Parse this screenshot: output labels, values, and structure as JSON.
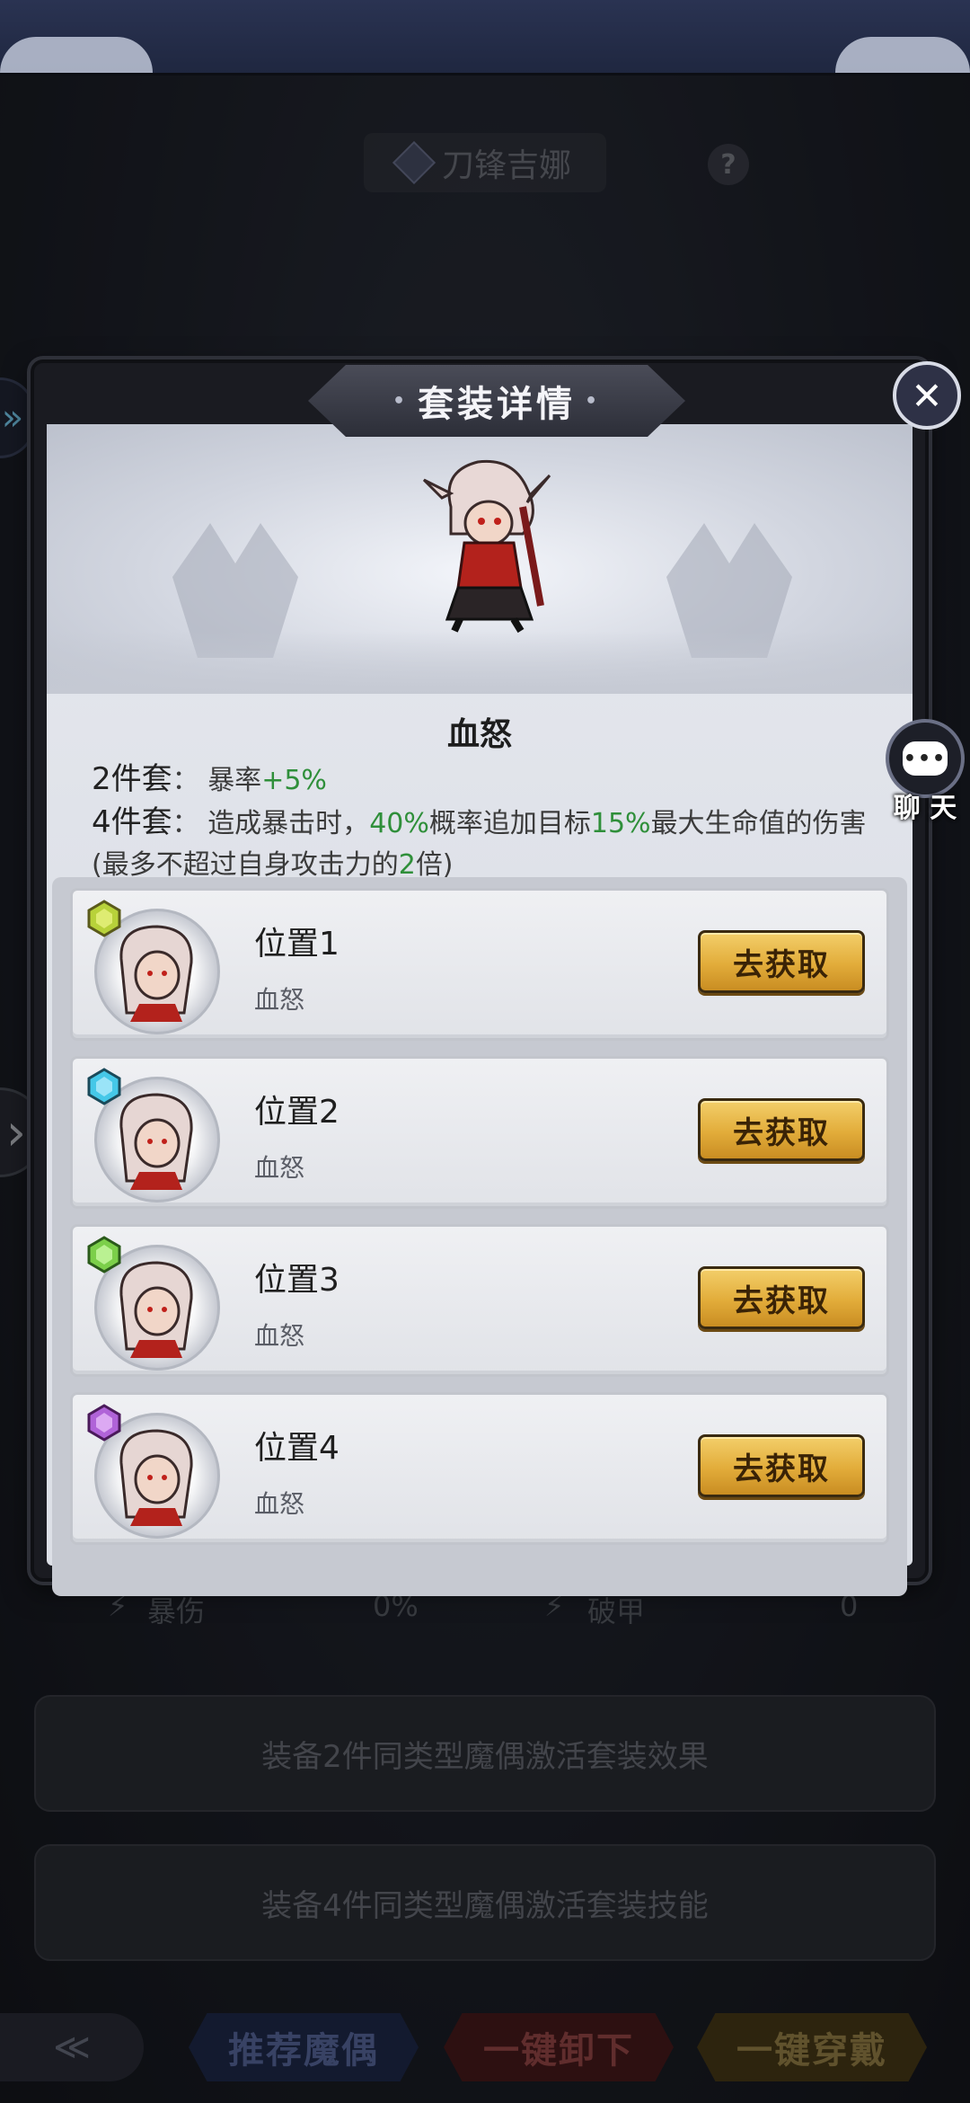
{
  "background": {
    "hero_name": "刀锋吉娜",
    "help_label": "?",
    "stats": [
      {
        "label": "暴伤",
        "value": "0%"
      },
      {
        "label": "破甲",
        "value": "0"
      }
    ],
    "hint_2": "装备2件同类型魔偶激活套装效果",
    "hint_4": "装备4件同类型魔偶激活套装技能",
    "buttons": {
      "recommend": "推荐魔偶",
      "unequip_all": "一键卸下",
      "equip_all": "一键穿戴"
    }
  },
  "chat": {
    "icon_text": "•••",
    "label": "聊 天"
  },
  "modal": {
    "title": "套装详情",
    "set_name": "血怒",
    "bonus_2": {
      "level": "2件套",
      "sep": "：",
      "text": "暴率",
      "value": "+5%"
    },
    "bonus_4": {
      "level": "4件套",
      "sep": "：",
      "t1": "造成暴击时，",
      "v1": "40%",
      "t2": "概率追加目标",
      "v2": "15%",
      "t3": "最大生命值的伤害(最多不超过自身攻击力的",
      "v3": "2",
      "t4": "倍)"
    },
    "slots": [
      {
        "title": "位置1",
        "subtitle": "血怒",
        "button": "去获取",
        "gem_color": "#b8d23a"
      },
      {
        "title": "位置2",
        "subtitle": "血怒",
        "button": "去获取",
        "gem_color": "#45c8e8"
      },
      {
        "title": "位置3",
        "subtitle": "血怒",
        "button": "去获取",
        "gem_color": "#7ccf4a"
      },
      {
        "title": "位置4",
        "subtitle": "血怒",
        "button": "去获取",
        "gem_color": "#b063d8"
      }
    ]
  },
  "colors": {
    "accent_green": "#2f8f3a",
    "button_gold": "#e2ac3a"
  }
}
